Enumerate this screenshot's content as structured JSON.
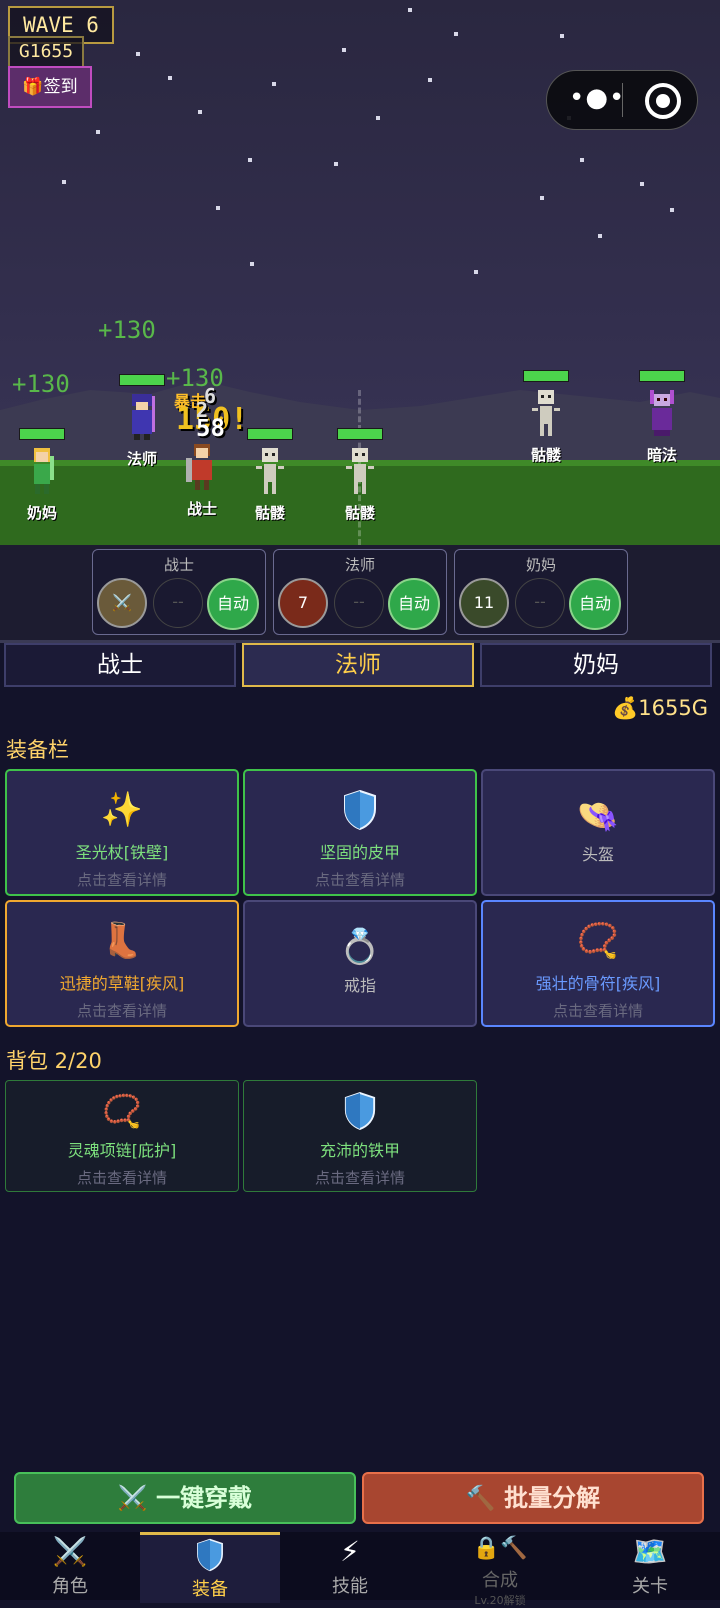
{
  "hud": {
    "wave": "WAVE  6",
    "gold": "G1655",
    "signin": "签到"
  },
  "heals": [
    "+130",
    "+130",
    "+130"
  ],
  "damage": {
    "crit": "暴击",
    "crit_value": "150!",
    "hit1": "58",
    "hit2": "6",
    "hit3": "2"
  },
  "units": {
    "nanny": "奶妈",
    "mage": "法师",
    "warrior": "战士",
    "skeleton1": "骷髅",
    "skeleton2": "骷髅",
    "skeleton3": "骷髅",
    "dark_mage": "暗法"
  },
  "hero_cards": [
    {
      "name": "战士",
      "skill_value": "",
      "empty": "--",
      "auto": "自动"
    },
    {
      "name": "法师",
      "skill_value": "7",
      "empty": "--",
      "auto": "自动"
    },
    {
      "name": "奶妈",
      "skill_value": "11",
      "empty": "--",
      "auto": "自动"
    }
  ],
  "tabs": [
    "战士",
    "法师",
    "奶妈"
  ],
  "gold_display": "💰1655G",
  "equip_section": "装备栏",
  "equip_slots": [
    {
      "icon": "sparkle-icon",
      "glyph": "✨",
      "name": "圣光杖[铁壁]",
      "detail": "点击查看详情",
      "color": "#7de07d"
    },
    {
      "icon": "shield-icon",
      "glyph": "",
      "name": "坚固的皮甲",
      "detail": "点击查看详情",
      "color": "#7de07d"
    },
    {
      "icon": "helmet-icon",
      "glyph": "👒",
      "name": "头盔",
      "detail": "",
      "color": "#bbbbbb"
    },
    {
      "icon": "boot-icon",
      "glyph": "👢",
      "name": "迅捷的草鞋[疾风]",
      "detail": "点击查看详情",
      "color": "#f0a830"
    },
    {
      "icon": "ring-icon",
      "glyph": "💍",
      "name": "戒指",
      "detail": "",
      "color": "#bbbbbb"
    },
    {
      "icon": "necklace-icon",
      "glyph": "📿",
      "name": "强壮的骨符[疾风]",
      "detail": "点击查看详情",
      "color": "#6a9aff"
    }
  ],
  "bag_section": "背包 2/20",
  "bag_items": [
    {
      "icon": "necklace-icon",
      "glyph": "📿",
      "name": "灵魂项链[庇护]",
      "detail": "点击查看详情"
    },
    {
      "icon": "shield-icon",
      "glyph": "",
      "name": "充沛的铁甲",
      "detail": "点击查看详情"
    }
  ],
  "actions": {
    "equip_all": "⚔️ 一键穿戴",
    "salvage": "🔨 批量分解"
  },
  "nav": [
    {
      "icon": "swords-icon",
      "glyph": "⚔️",
      "label": "角色"
    },
    {
      "icon": "shield-icon",
      "glyph": "",
      "label": "装备"
    },
    {
      "icon": "lightning-icon",
      "glyph": "⚡",
      "label": "技能"
    },
    {
      "icon": "lock-hammer-icon",
      "glyph": "🔒🔨",
      "label": "合成",
      "lock": "Lv.20解锁"
    },
    {
      "icon": "map-icon",
      "glyph": "🗺️",
      "label": "关卡"
    }
  ]
}
